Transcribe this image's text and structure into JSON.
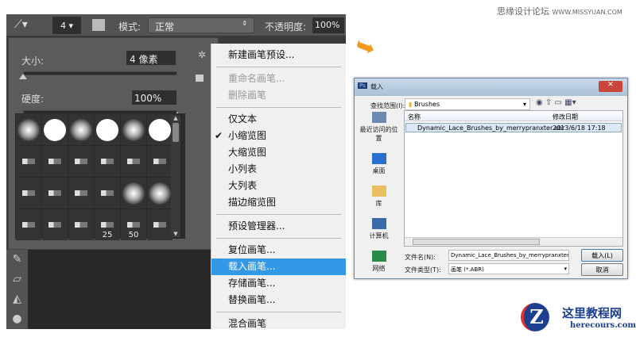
{
  "watermark": {
    "site_cn": "思缘设计论坛",
    "site_url": "WWW.MISSYUAN.COM"
  },
  "toolbar": {
    "brush_size": "4",
    "mode_label": "模式:",
    "mode_value": "正常",
    "opacity_label": "不透明度:",
    "opacity_value": "100%"
  },
  "brush_panel": {
    "size_label": "大小:",
    "size_value": "4 像素",
    "size_fraction": 0.0,
    "hardness_label": "硬度:",
    "hardness_value": "100%",
    "hardness_fraction": 1.0,
    "presets": [
      "soft",
      "hard",
      "soft",
      "hard",
      "soft",
      "hard",
      "tip",
      "tip",
      "tip",
      "tip",
      "tip",
      "tip",
      "tip",
      "tip",
      "tip",
      "tip",
      "soft",
      "soft",
      "tip",
      "tip",
      "tip",
      "tip",
      "tip",
      "tip"
    ],
    "preset_labels": {
      "21": "25",
      "22": "50"
    }
  },
  "menu": {
    "items": [
      {
        "label": "新建画笔预设..."
      },
      {
        "sep": true
      },
      {
        "label": "重命名画笔...",
        "disabled": true
      },
      {
        "label": "删除画笔",
        "disabled": true
      },
      {
        "sep": true
      },
      {
        "label": "仅文本"
      },
      {
        "label": "小缩览图",
        "checked": true
      },
      {
        "label": "大缩览图"
      },
      {
        "label": "小列表"
      },
      {
        "label": "大列表"
      },
      {
        "label": "描边缩览图"
      },
      {
        "sep": true
      },
      {
        "label": "预设管理器..."
      },
      {
        "sep": true
      },
      {
        "label": "复位画笔..."
      },
      {
        "label": "载入画笔...",
        "selected": true
      },
      {
        "label": "存储画笔..."
      },
      {
        "label": "替换画笔..."
      },
      {
        "sep": true
      },
      {
        "label": "混合画笔"
      }
    ],
    "check": "✔"
  },
  "dialog": {
    "app_icon": "Ps",
    "title": "载入",
    "lookin_label": "查找范围(I):",
    "lookin_value": "Brushes",
    "places": [
      "最近访问的位置",
      "桌面",
      "库",
      "计算机",
      "网络"
    ],
    "columns": [
      "名称",
      "修改日期"
    ],
    "files": [
      {
        "name": "Dynamic_Lace_Brushes_by_merrypranxter.abr",
        "date": "2013/6/18 17:18"
      }
    ],
    "filename_label": "文件名(N):",
    "filename_value": "Dynamic_Lace_Brushes_by_merrypranxter.abr",
    "filetype_label": "文件类型(T):",
    "filetype_value": "画笔 (*.ABR)",
    "load_button": "载入(L)",
    "cancel_button": "取消",
    "close": "✕"
  },
  "logo": {
    "name": "这里教程网",
    "url": "herecours.com"
  },
  "colors": {
    "arrow": "#f29a1f",
    "highlight": "#3399e6"
  }
}
